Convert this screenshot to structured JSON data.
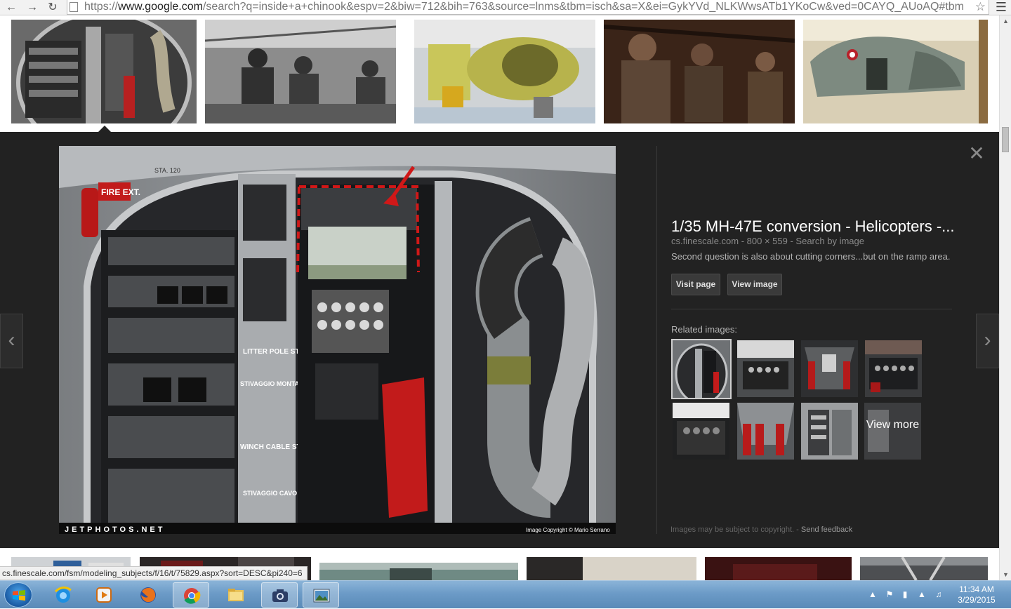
{
  "browser": {
    "url_prefix": "https://",
    "url_domain": "www.google.com",
    "url_rest": "/search?q=inside+a+chinook&espv=2&biw=712&bih=763&source=lnms&tbm=isch&sa=X&ei=GykYVd_NLKWwsATb1YKoCw&ved=0CAYQ_AUoAQ#tbm",
    "back_icon": "back-arrow-icon",
    "forward_icon": "forward-arrow-icon",
    "reload_icon": "reload-icon",
    "menu_icon": "hamburger-menu-icon"
  },
  "panel": {
    "title": "1/35 MH-47E conversion - Helicopters -...",
    "source": "cs.finescale.com",
    "dimensions": "800 × 559",
    "search_by_image": "Search by image",
    "meta_sep": " - ",
    "description": "Second question is also about cutting corners...but on the ramp area.",
    "visit_page": "Visit page",
    "view_image": "View image",
    "related_label": "Related images:",
    "view_more": "View more",
    "footnote": "Images may be subject to copyright.",
    "footnote_sep": " - ",
    "send_feedback": "Send feedback",
    "watermark_left": "JETPHOTOS.NET",
    "watermark_right": "Image Copyright © Mario Serrano",
    "labels": {
      "litter": "LITTER POLE STOWAGE",
      "stivaggio": "STIVAGGIO MONTANTE BARELLE",
      "winch": "WINCH CABLE STOWAGE",
      "stivaggio2": "STIVAGGIO CAVO VERRICELLO",
      "fire": "FIRE EXT.",
      "sta": "STA. 120"
    }
  },
  "status_url": "cs.finescale.com/fsm/modeling_subjects/f/16/t/75829.aspx?sort=DESC&pi240=6",
  "clock": {
    "time": "11:34 AM",
    "date": "3/29/2015"
  },
  "colors": {
    "panel_bg": "#222222",
    "taskbar": "#6c9bc7",
    "accent_red": "#c01a1a"
  }
}
